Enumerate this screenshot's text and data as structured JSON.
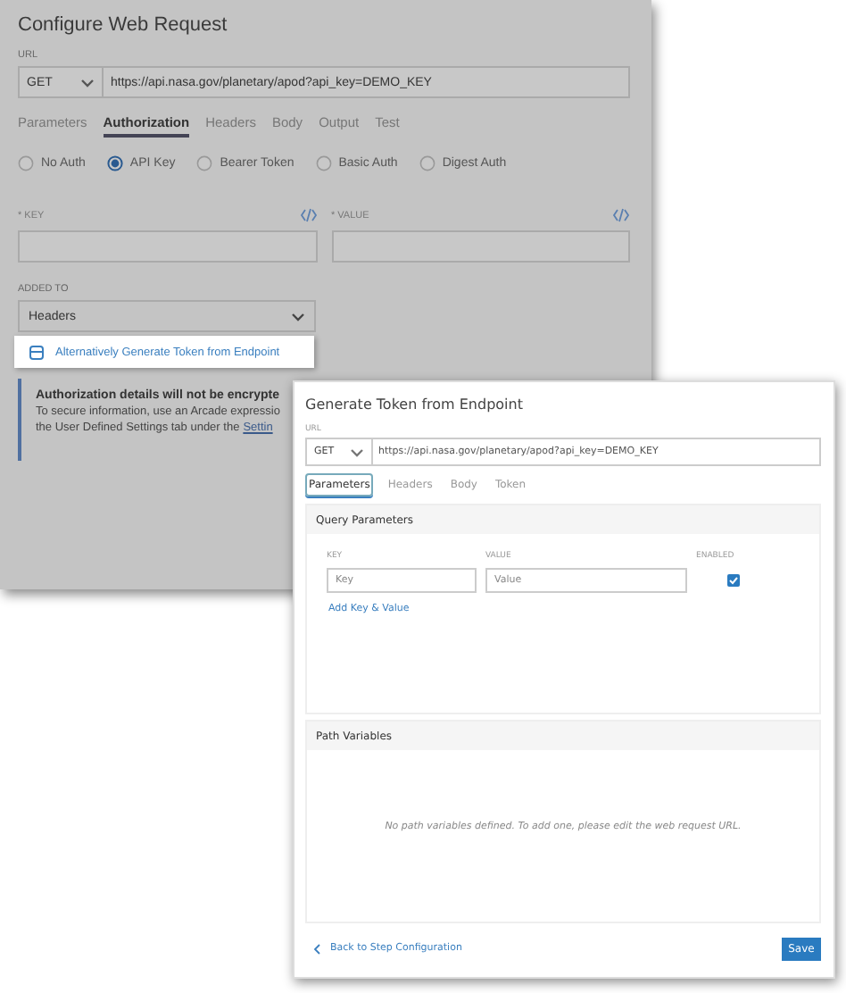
{
  "configure_request": {
    "title": "Configure Web Request",
    "url_label": "URL",
    "method": "GET",
    "url": "https://api.nasa.gov/planetary/apod?api_key=DEMO_KEY",
    "tabs": [
      {
        "label": "Parameters",
        "selected": false
      },
      {
        "label": "Authorization",
        "selected": true
      },
      {
        "label": "Headers",
        "selected": false
      },
      {
        "label": "Body",
        "selected": false
      },
      {
        "label": "Output",
        "selected": false
      },
      {
        "label": "Test",
        "selected": false
      }
    ],
    "auth_options": [
      {
        "label": "No Auth",
        "selected": false
      },
      {
        "label": "API Key",
        "selected": true
      },
      {
        "label": "Bearer Token",
        "selected": false
      },
      {
        "label": "Basic Auth",
        "selected": false
      },
      {
        "label": "Digest Auth",
        "selected": false
      }
    ],
    "key_label": "* KEY",
    "value_label": "* VALUE",
    "added_to_label": "ADDED TO",
    "added_to": "Headers",
    "generate_link": "Alternatively Generate Token from Endpoint",
    "notice": {
      "title": "Authorization details will not be encrypte",
      "line_1": "To secure information, use an Arcade expressio",
      "line_2": "the User Defined Settings tab under the",
      "link": "Settin"
    }
  },
  "generate_token": {
    "title": "Generate Token from Endpoint",
    "url_label": "URL",
    "method": "GET",
    "url": "https://api.nasa.gov/planetary/apod?api_key=DEMO_KEY",
    "tabs": [
      {
        "label": "Parameters",
        "selected": true
      },
      {
        "label": "Headers",
        "selected": false
      },
      {
        "label": "Body",
        "selected": false
      },
      {
        "label": "Token",
        "selected": false
      }
    ],
    "query_parameters": {
      "title": "Query Parameters",
      "columns": [
        "KEY",
        "VALUE",
        "ENABLED"
      ],
      "rows": [
        {
          "key_placeholder": "Key",
          "value_placeholder": "Value",
          "enabled": true
        }
      ],
      "add_link": "Add Key & Value"
    },
    "path_variables": {
      "title": "Path Variables",
      "empty_message": "No path variables defined. To add one, please edit the web request URL."
    },
    "back_link": "Back to Step Configuration",
    "save_button": "Save"
  }
}
